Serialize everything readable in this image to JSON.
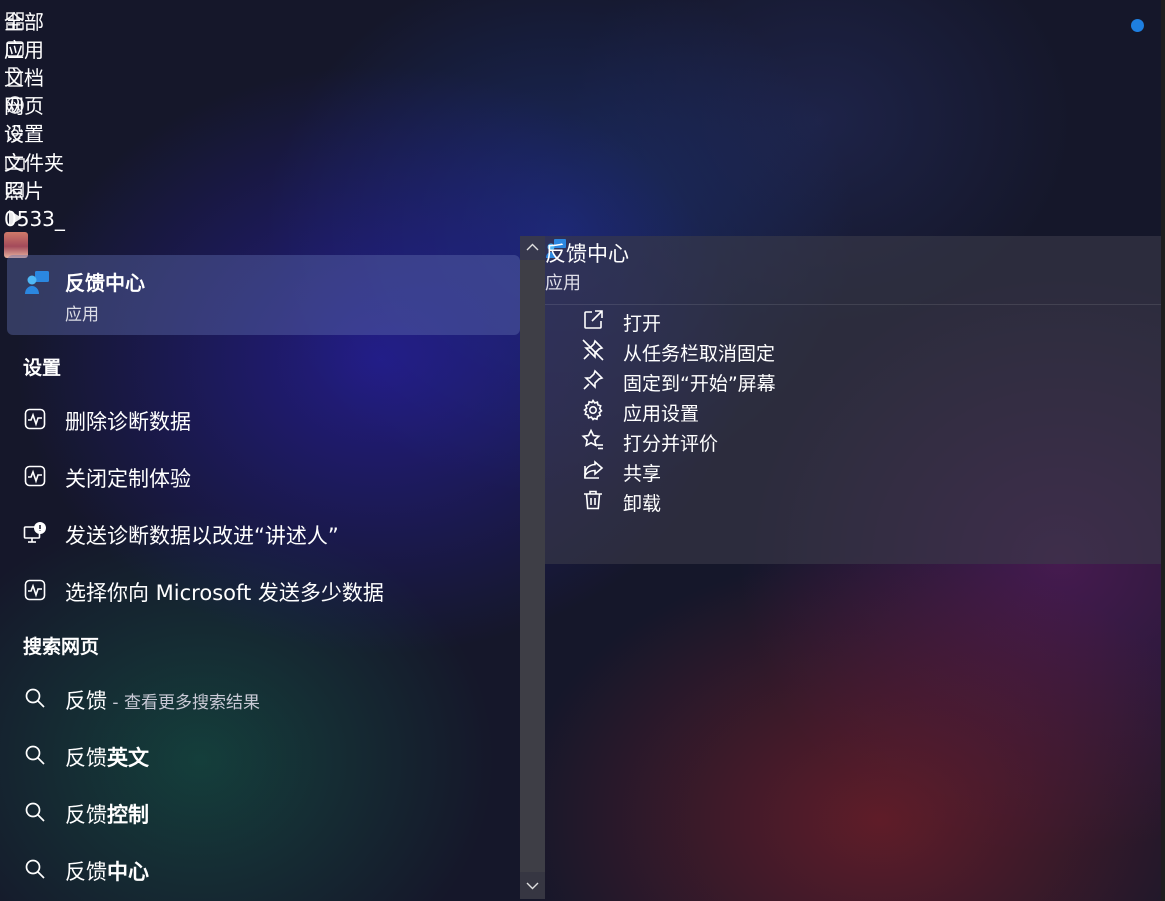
{
  "filters": [
    {
      "label": "全部",
      "icon": "apps-icon"
    },
    {
      "label": "应用",
      "icon": "app-icon"
    },
    {
      "label": "文档",
      "icon": "document-icon"
    },
    {
      "label": "网页",
      "icon": "globe-icon"
    },
    {
      "label": "设置",
      "icon": "gear-icon"
    },
    {
      "label": "文件夹",
      "icon": "folder-icon"
    },
    {
      "label": "照片",
      "icon": "photo-icon"
    },
    {
      "label": "0533_",
      "icon": "play-icon"
    }
  ],
  "best_match": {
    "title": "反馈中心",
    "subtitle": "应用"
  },
  "settings_section": {
    "heading": "设置",
    "items": [
      {
        "label": "删除诊断数据",
        "icon": "diagnostics-icon"
      },
      {
        "label": "关闭定制体验",
        "icon": "diagnostics-icon"
      },
      {
        "label": "发送诊断数据以改进“讲述人”",
        "icon": "narrator-icon"
      },
      {
        "label": "选择你向 Microsoft 发送多少数据",
        "icon": "diagnostics-icon"
      }
    ]
  },
  "web_section": {
    "heading": "搜索网页",
    "items": [
      {
        "prefix": "反馈",
        "suffix": " - 查看更多搜索结果",
        "bold": ""
      },
      {
        "prefix": "反馈",
        "suffix": "",
        "bold": "英文"
      },
      {
        "prefix": "反馈",
        "suffix": "",
        "bold": "控制"
      },
      {
        "prefix": "反馈",
        "suffix": "",
        "bold": "中心"
      }
    ]
  },
  "preview": {
    "title": "反馈中心",
    "subtitle": "应用",
    "actions": [
      {
        "label": "打开",
        "icon": "open-external-icon"
      },
      {
        "label": "从任务栏取消固定",
        "icon": "unpin-icon"
      },
      {
        "label": "固定到“开始”屏幕",
        "icon": "pin-icon"
      },
      {
        "label": "应用设置",
        "icon": "gear-icon"
      },
      {
        "label": "打分并评价",
        "icon": "rate-review-icon"
      },
      {
        "label": "共享",
        "icon": "share-icon"
      },
      {
        "label": "卸载",
        "icon": "trash-icon"
      }
    ]
  },
  "colors": {
    "accent": "#1e7fe0",
    "selection": "#5f6eaf"
  }
}
